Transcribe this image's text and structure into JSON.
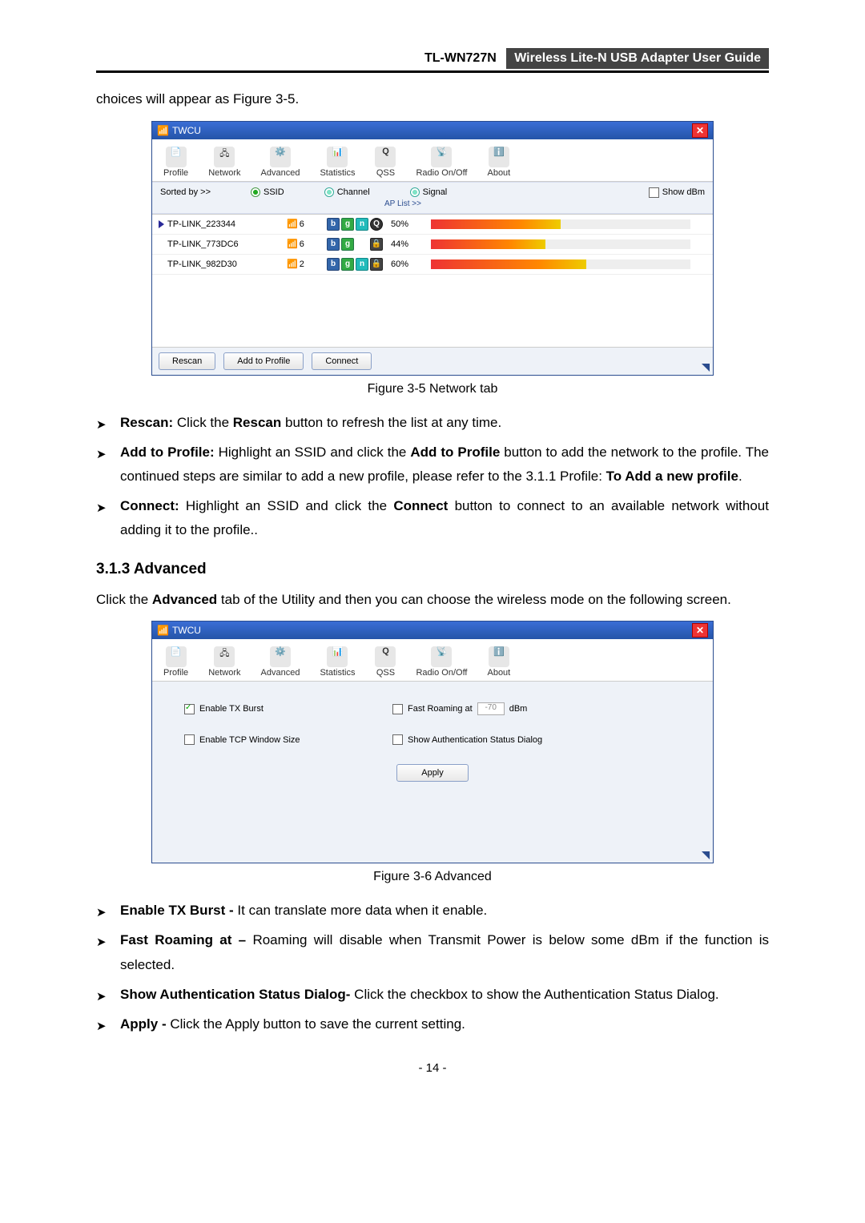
{
  "header": {
    "model": "TL-WN727N",
    "title": "Wireless Lite-N USB Adapter User Guide"
  },
  "intro_line": "choices will appear as Figure 3-5.",
  "fig35": {
    "window_title": "TWCU",
    "tabs": [
      "Profile",
      "Network",
      "Advanced",
      "Statistics",
      "QSS",
      "Radio On/Off",
      "About"
    ],
    "sorted_label": "Sorted by >>",
    "col_ssid": "SSID",
    "col_channel": "Channel",
    "col_signal": "Signal",
    "ap_list_label": "AP List >>",
    "show_dbm": "Show dBm",
    "rows": [
      {
        "ssid": "TP-LINK_223344",
        "active": true,
        "channel": "6",
        "caps": [
          "b",
          "g",
          "n",
          "Q"
        ],
        "pct": "50%",
        "sig": 50
      },
      {
        "ssid": "TP-LINK_773DC6",
        "active": false,
        "channel": "6",
        "caps": [
          "b",
          "g",
          "L"
        ],
        "pct": "44%",
        "sig": 44
      },
      {
        "ssid": "TP-LINK_982D30",
        "active": false,
        "channel": "2",
        "caps": [
          "b",
          "g",
          "n",
          "L"
        ],
        "pct": "60%",
        "sig": 60
      }
    ],
    "buttons": {
      "rescan": "Rescan",
      "add": "Add to Profile",
      "connect": "Connect"
    }
  },
  "fig35_caption": "Figure 3-5 Network tab",
  "bullets1": {
    "rescan": {
      "label": "Rescan:",
      "text_a": " Click the ",
      "bold_a": "Rescan",
      "text_b": " button to refresh the list at any time."
    },
    "add": {
      "label": "Add to Profile:",
      "text_a": " Highlight an SSID and click the ",
      "bold_a": "Add to Profile",
      "text_b": " button to add the network to the profile. The continued steps are similar to add a new profile, please refer to the 3.1.1 Profile: ",
      "bold_b": "To Add a new profile",
      "text_c": "."
    },
    "connect": {
      "label": "Connect:",
      "text_a": " Highlight an SSID and click the ",
      "bold_a": "Connect",
      "text_b": " button to connect to an available network without adding it to the profile.."
    }
  },
  "section_313": "3.1.3 Advanced",
  "section_313_body_a": "Click the ",
  "section_313_body_bold": "Advanced",
  "section_313_body_b": " tab of the Utility and then you can choose the wireless mode on the following screen.",
  "fig36": {
    "window_title": "TWCU",
    "tabs": [
      "Profile",
      "Network",
      "Advanced",
      "Statistics",
      "QSS",
      "Radio On/Off",
      "About"
    ],
    "opt_tx": "Enable TX Burst",
    "opt_tcp": "Enable TCP Window Size",
    "opt_roam": "Fast Roaming at",
    "opt_roam_val": "-70",
    "opt_roam_unit": "dBm",
    "opt_auth": "Show Authentication Status Dialog",
    "apply": "Apply"
  },
  "fig36_caption": "Figure 3-6 Advanced",
  "bullets2": {
    "tx": {
      "label": "Enable TX Burst -",
      "text": " It can translate more data when it enable."
    },
    "roam": {
      "label": "Fast Roaming at –",
      "text": " Roaming will disable when Transmit Power is below some dBm if the function is selected."
    },
    "auth": {
      "label": "Show Authentication Status Dialog-",
      "text": " Click the checkbox to show the Authentication Status Dialog."
    },
    "apply": {
      "label": "Apply -",
      "text": " Click the Apply button to save the current setting."
    }
  },
  "page_number": "- 14 -"
}
